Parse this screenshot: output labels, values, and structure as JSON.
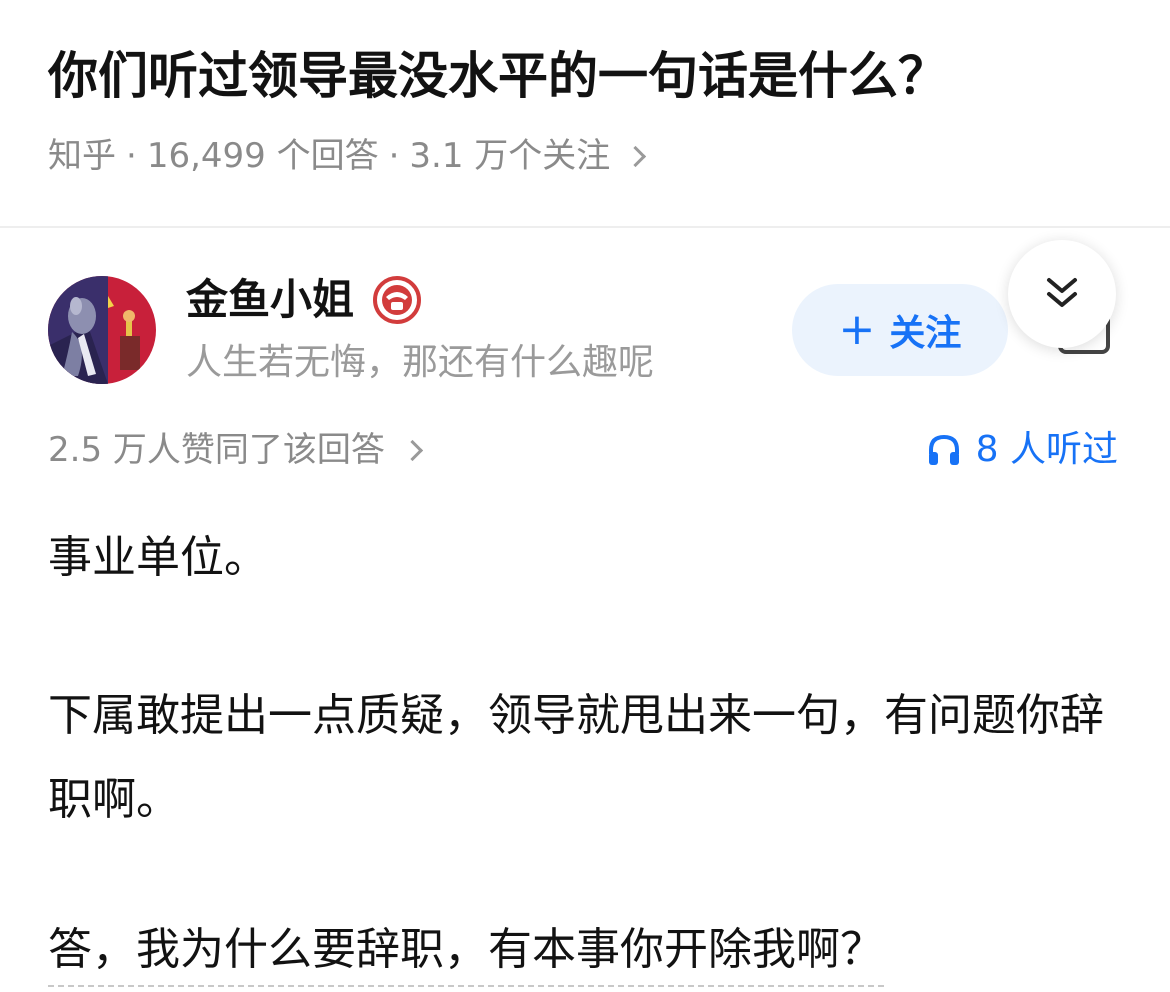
{
  "question": {
    "title": "你们听过领导最没水平的一句话是什么？",
    "source": "知乎",
    "answer_count": "16,499 个回答",
    "follow_count": "3.1 万个关注"
  },
  "author": {
    "name": "金鱼小姐",
    "bio": "人生若无悔，那还有什么趣呢",
    "follow_label": "关注"
  },
  "answer_meta": {
    "upvote_summary": "2.5 万人赞同了该回答",
    "listen_count": "8 人听过"
  },
  "answer": {
    "paragraphs": [
      "事业单位。",
      "下属敢提出一点质疑，领导就甩出来一句，有问题你辞职啊。",
      "答，我为什么要辞职，有本事你开除我啊？"
    ]
  },
  "icons": {
    "meta_chevron": "chevron-right-icon",
    "collapse": "double-chevron-down-icon",
    "listen": "headphones-icon",
    "badge": "verified-badge-icon",
    "follow_plus": "plus-icon",
    "share": "share-icon"
  },
  "colors": {
    "accent": "#1772f6",
    "follow_bg": "#ebf3fd",
    "meta_text": "#8a8a8a",
    "badge": "#d23c3c"
  }
}
